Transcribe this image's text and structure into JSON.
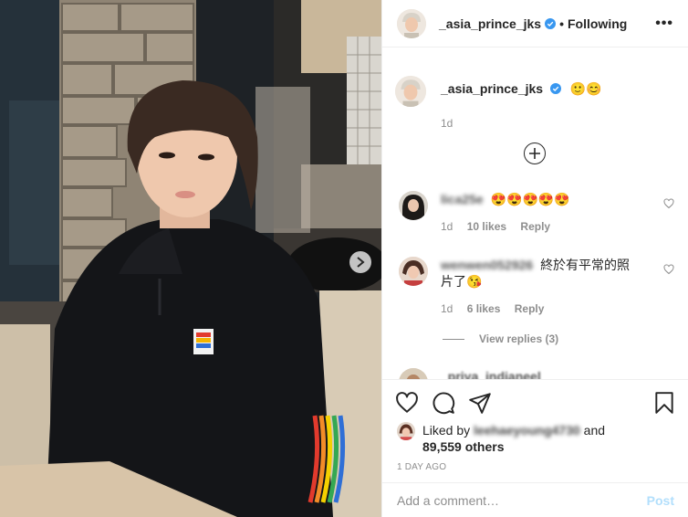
{
  "header": {
    "username": "_asia_prince_jks",
    "separator": "•",
    "follow_status": "Following",
    "more": "•••"
  },
  "caption": {
    "username": "_asia_prince_jks",
    "emoji": "🙂😊",
    "time": "1d"
  },
  "comments": [
    {
      "username": "lica25e",
      "text": "😍😍😍😍😍",
      "time": "1d",
      "likes": "10 likes",
      "reply": "Reply"
    },
    {
      "username": "wenwen052926",
      "text": "終於有平常的照片了😘",
      "time": "1d",
      "likes": "6 likes",
      "reply": "Reply"
    },
    {
      "username": "_priya_indianeel",
      "text": "",
      "time": "",
      "likes": "",
      "reply": ""
    }
  ],
  "view_replies": "View replies (3)",
  "likes": {
    "liked_by_prefix": "Liked by",
    "liked_by_user": "leehaeyoung4730",
    "and": "and",
    "others": "89,559 others"
  },
  "timestamp": "1 DAY AGO",
  "comment_input": {
    "placeholder": "Add a comment…",
    "value": ""
  },
  "post_button": "Post",
  "colors": {
    "verified": "#3897f0",
    "post_disabled": "#b2dffc",
    "muted": "#8e8e8e"
  }
}
